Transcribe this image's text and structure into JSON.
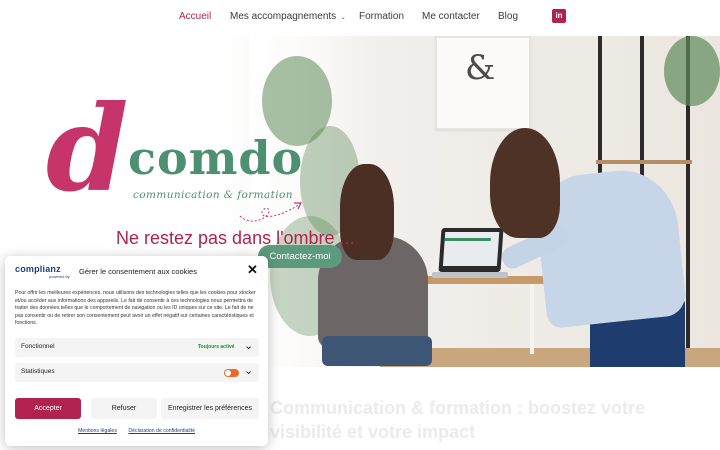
{
  "nav": {
    "items": [
      {
        "label": "Accueil",
        "active": true
      },
      {
        "label": "Mes accompagnements",
        "dropdown": true
      },
      {
        "label": "Formation"
      },
      {
        "label": "Me contacter"
      },
      {
        "label": "Blog"
      }
    ],
    "social_icon": "linkedin-icon",
    "social_icon_text": "in"
  },
  "hero": {
    "logo": {
      "d": "d",
      "name": "comdo",
      "subtitle": "communication & formation"
    },
    "frame_symbol": "&",
    "tagline": "Ne restez pas dans l'ombre ...",
    "cta_label": "Contactez-moi"
  },
  "below": {
    "line1": "Communication & formation : boostez votre",
    "line2": "visibilité et votre impact"
  },
  "consent": {
    "brand": "complianz",
    "brand_sub": "powered by",
    "title": "Gérer le consentement aux cookies",
    "body": "Pour offrir les meilleures expériences, nous utilisons des technologies telles que les cookies pour stocker et/ou accéder aux informations des appareils. Le fait de consentir à ces technologies nous permettra de traiter des données telles que le comportement de navigation ou les ID uniques sur ce site. Le fait de ne pas consentir ou de retirer son consentement peut avoir un effet négatif sur certaines caractéristiques et fonctions.",
    "rows": [
      {
        "label": "Fonctionnel",
        "state": "Toujours activé"
      },
      {
        "label": "Statistiques"
      }
    ],
    "accept_label": "Accepter",
    "refuse_label": "Refuser",
    "prefs_label": "Enregistrer les préférences",
    "link_legal": "Mentions légales",
    "link_privacy": "Déclaration de confidentialité"
  },
  "colors": {
    "accent": "#b1224f",
    "green": "#5b9a7d",
    "logo_pink": "#c7346a",
    "logo_green": "#4d8f73"
  }
}
